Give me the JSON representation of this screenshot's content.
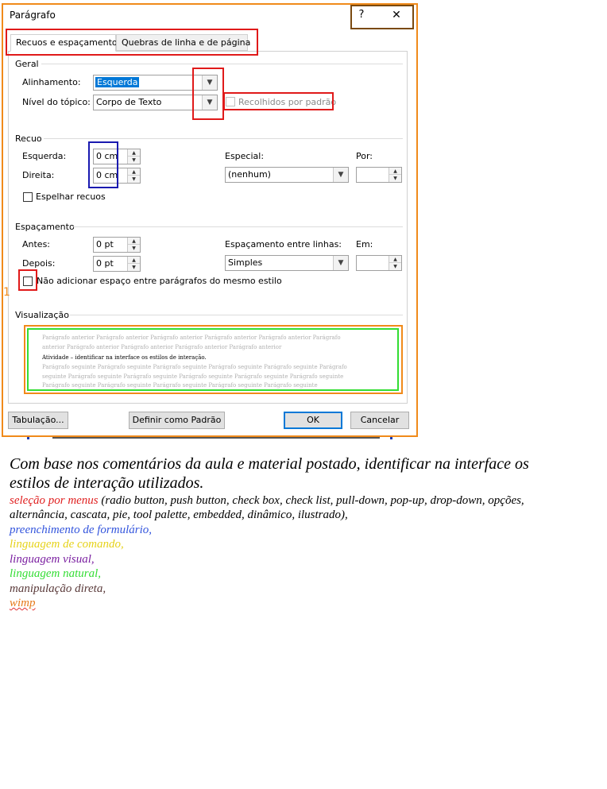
{
  "dialog": {
    "title": "Parágrafo",
    "help_glyph": "?",
    "close_glyph": "✕",
    "tabs": [
      {
        "label": "Recuos e espaçamento"
      },
      {
        "label": "Quebras de linha e de página"
      }
    ],
    "geral": {
      "heading": "Geral",
      "alinhamento_label": "Alinhamento:",
      "alinhamento_value": "Esquerda",
      "nivel_label": "Nível do tópico:",
      "nivel_value": "Corpo de Texto",
      "recolhidos_label": "Recolhidos por padrão"
    },
    "recuo": {
      "heading": "Recuo",
      "esquerda_label": "Esquerda:",
      "esquerda_value": "0 cm",
      "direita_label": "Direita:",
      "direita_value": "0 cm",
      "especial_label": "Especial:",
      "especial_value": "(nenhum)",
      "por_label": "Por:",
      "por_value": "",
      "espelhar_label": "Espelhar recuos"
    },
    "espacamento": {
      "heading": "Espaçamento",
      "antes_label": "Antes:",
      "antes_value": "0 pt",
      "depois_label": "Depois:",
      "depois_value": "0 pt",
      "entre_linhas_label": "Espaçamento entre linhas:",
      "entre_linhas_value": "Simples",
      "em_label": "Em:",
      "em_value": "",
      "nao_adicionar_label": "Não adicionar espaço entre parágrafos do mesmo estilo"
    },
    "visualizacao": {
      "heading": "Visualização",
      "lines": [
        "Parágrafo anterior Parágrafo anterior Parágrafo anterior Parágrafo anterior Parágrafo anterior Parágrafo",
        "anterior Parágrafo anterior Parágrafo anterior Parágrafo anterior Parágrafo anterior",
        "Atividade – identificar na interface os estilos de interação.",
        "Parágrafo seguinte Parágrafo seguinte Parágrafo seguinte Parágrafo seguinte Parágrafo seguinte Parágrafo",
        "seguinte Parágrafo seguinte Parágrafo seguinte Parágrafo seguinte Parágrafo seguinte Parágrafo seguinte",
        "Parágrafo seguinte Parágrafo seguinte Parágrafo seguinte Parágrafo seguinte Parágrafo seguinte"
      ]
    },
    "buttons": {
      "tabulacao": "Tabulação...",
      "definir_padrao": "Definir como Padrão",
      "ok": "OK",
      "cancelar": "Cancelar"
    }
  },
  "annotation_marker": "1",
  "document": {
    "question_line1": "Com base nos comentários da aula e material postado, identificar na interface os",
    "question_line2": "estilos de interação utilizados.",
    "menus_term": "seleção por menus",
    "menus_rest_line1": " (radio button, push button, check box, check list, pull-down, pop-up, drop-down, opções,",
    "menus_rest_line2": "alternância, cascata, pie, tool palette, embedded, dinâmico, ilustrado),",
    "items": [
      {
        "text": "preenchimento de formulário,",
        "color": "#3355dd"
      },
      {
        "text": "linguagem de comando,",
        "color": "#e6d21a"
      },
      {
        "text": "linguagem visual,",
        "color": "#7a1fa0"
      },
      {
        "text": "linguagem natural,",
        "color": "#33dd33"
      },
      {
        "text": "manipulação direta,",
        "color": "#5a3a3a"
      },
      {
        "text": "wimp",
        "color": "#e67a1a"
      }
    ],
    "menus_color": "#e02020"
  },
  "colors": {
    "annotation_red": "#e01a1a",
    "annotation_blue": "#1a1ab0",
    "annotation_green": "#33dd33",
    "annotation_orange": "#f08a1a",
    "annotation_brown": "#7a4a10",
    "accent": "#0078d7"
  }
}
